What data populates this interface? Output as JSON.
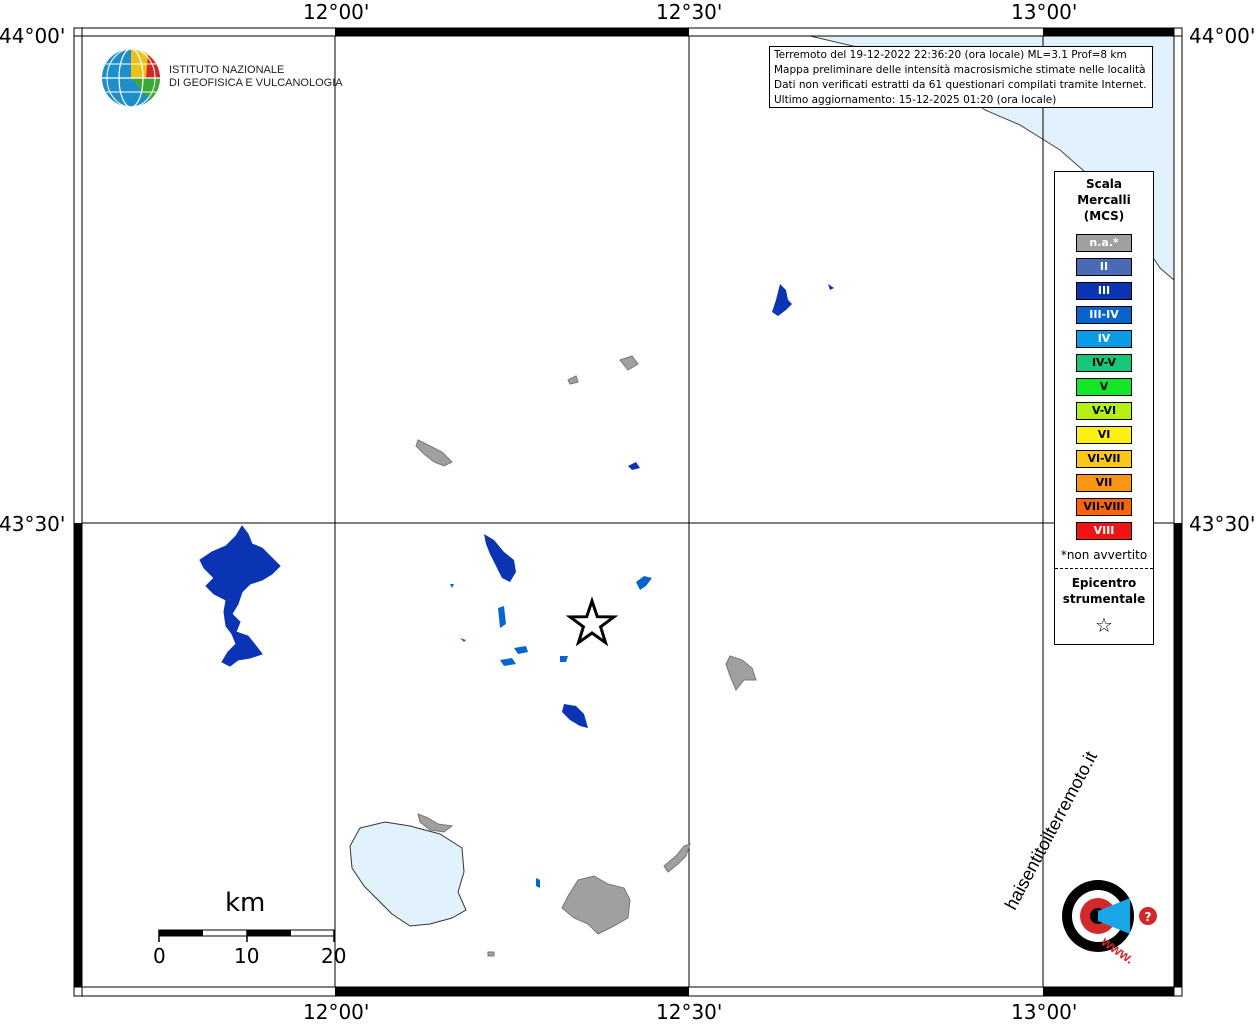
{
  "graticule": {
    "lon_labels": [
      "12°00'",
      "12°30'",
      "13°00'"
    ],
    "lat_labels": [
      "44°00'",
      "43°30'"
    ]
  },
  "logo": {
    "line1": "ISTITUTO NAZIONALE",
    "line2": "DI GEOFISICA E VULCANOLOGIA"
  },
  "info": {
    "line1": "Terremoto del 19-12-2022 22:36:20 (ora locale) ML=3.1 Prof=8 km",
    "line2": "Mappa preliminare delle intensità macrosismiche stimate nelle località",
    "line3": "Dati non verificati estratti da 61 questionari compilati tramite Internet.",
    "line4": "Ultimo aggiornamento: 15-12-2025 01:20 (ora locale)"
  },
  "legend": {
    "title_line1": "Scala",
    "title_line2": "Mercalli",
    "title_line3": "(MCS)",
    "items": [
      {
        "label": "n.a.*",
        "color": "#a0a0a0",
        "text_color": "#ffffff"
      },
      {
        "label": "II",
        "color": "#4a6ab8",
        "text_color": "#ffffff"
      },
      {
        "label": "III",
        "color": "#0a34b4",
        "text_color": "#ffffff"
      },
      {
        "label": "III-IV",
        "color": "#0a64d0",
        "text_color": "#ffffff"
      },
      {
        "label": "IV",
        "color": "#0a9ae6",
        "text_color": "#ffffff"
      },
      {
        "label": "IV-V",
        "color": "#14c878",
        "text_color": "#000000"
      },
      {
        "label": "V",
        "color": "#14e628",
        "text_color": "#000000"
      },
      {
        "label": "V-VI",
        "color": "#b4f014",
        "text_color": "#000000"
      },
      {
        "label": "VI",
        "color": "#faf014",
        "text_color": "#000000"
      },
      {
        "label": "VI-VII",
        "color": "#fac814",
        "text_color": "#000000"
      },
      {
        "label": "VII",
        "color": "#fa9614",
        "text_color": "#000000"
      },
      {
        "label": "VII-VIII",
        "color": "#fa640a",
        "text_color": "#000000"
      },
      {
        "label": "VIII",
        "color": "#f01414",
        "text_color": "#ffffff"
      }
    ],
    "note": "*non avvertito",
    "epi_line1": "Epicentro",
    "epi_line2": "strumentale",
    "star": "☆"
  },
  "scalebar": {
    "title": "km",
    "labels": [
      "0",
      "10",
      "20"
    ]
  },
  "watermark": {
    "text": "haisentitoilterremoto.it",
    "url": "www."
  },
  "colors": {
    "sea": "#e2f2fc",
    "not_felt": "#a0a0a0",
    "mcs_III": "#0a34b4",
    "mcs_III_IV": "#0a64d0"
  }
}
